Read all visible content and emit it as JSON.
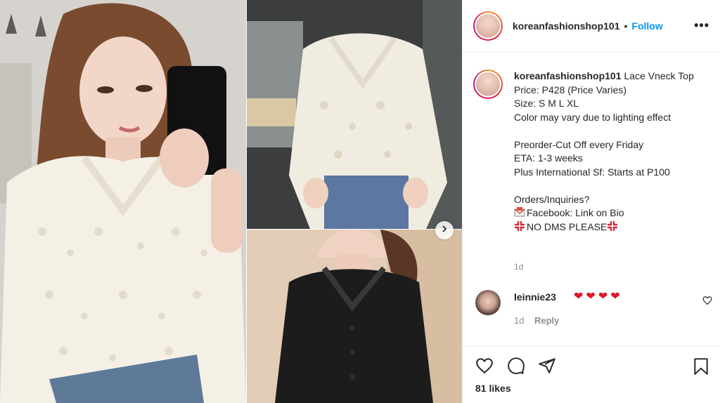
{
  "post": {
    "username": "koreanfashionshop101",
    "follow_label": "Follow",
    "separator": "•",
    "more_label": "•••"
  },
  "caption": {
    "username": "koreanfashionshop101",
    "lines": [
      "Lace Vneck Top",
      "Price: P428 (Price Varies)",
      "Size: S M L XL",
      "Color may vary due to lighting effect",
      "",
      "Preorder-Cut Off every Friday",
      "ETA: 1-3 weeks",
      "Plus International Sf: Starts at P100",
      "",
      "Orders/Inquiries?",
      "Facebook: Link on Bio",
      "NO DMS PLEASE"
    ],
    "time": "1d"
  },
  "comment": {
    "username": "leinnie23",
    "hearts": [
      "❤",
      "❤",
      "❤",
      "❤"
    ],
    "time": "1d",
    "reply_label": "Reply"
  },
  "likes": "81 likes",
  "colors": {
    "follow": "#0095f6",
    "text": "#262626",
    "muted": "#8e8e8e",
    "heart": "#e0142b"
  },
  "icons": {
    "header_avatar": "avatar",
    "next": "chevron-right-icon",
    "like": "heart-outline-icon",
    "comment": "comment-bubble-icon",
    "share": "paper-plane-icon",
    "save": "bookmark-icon"
  }
}
